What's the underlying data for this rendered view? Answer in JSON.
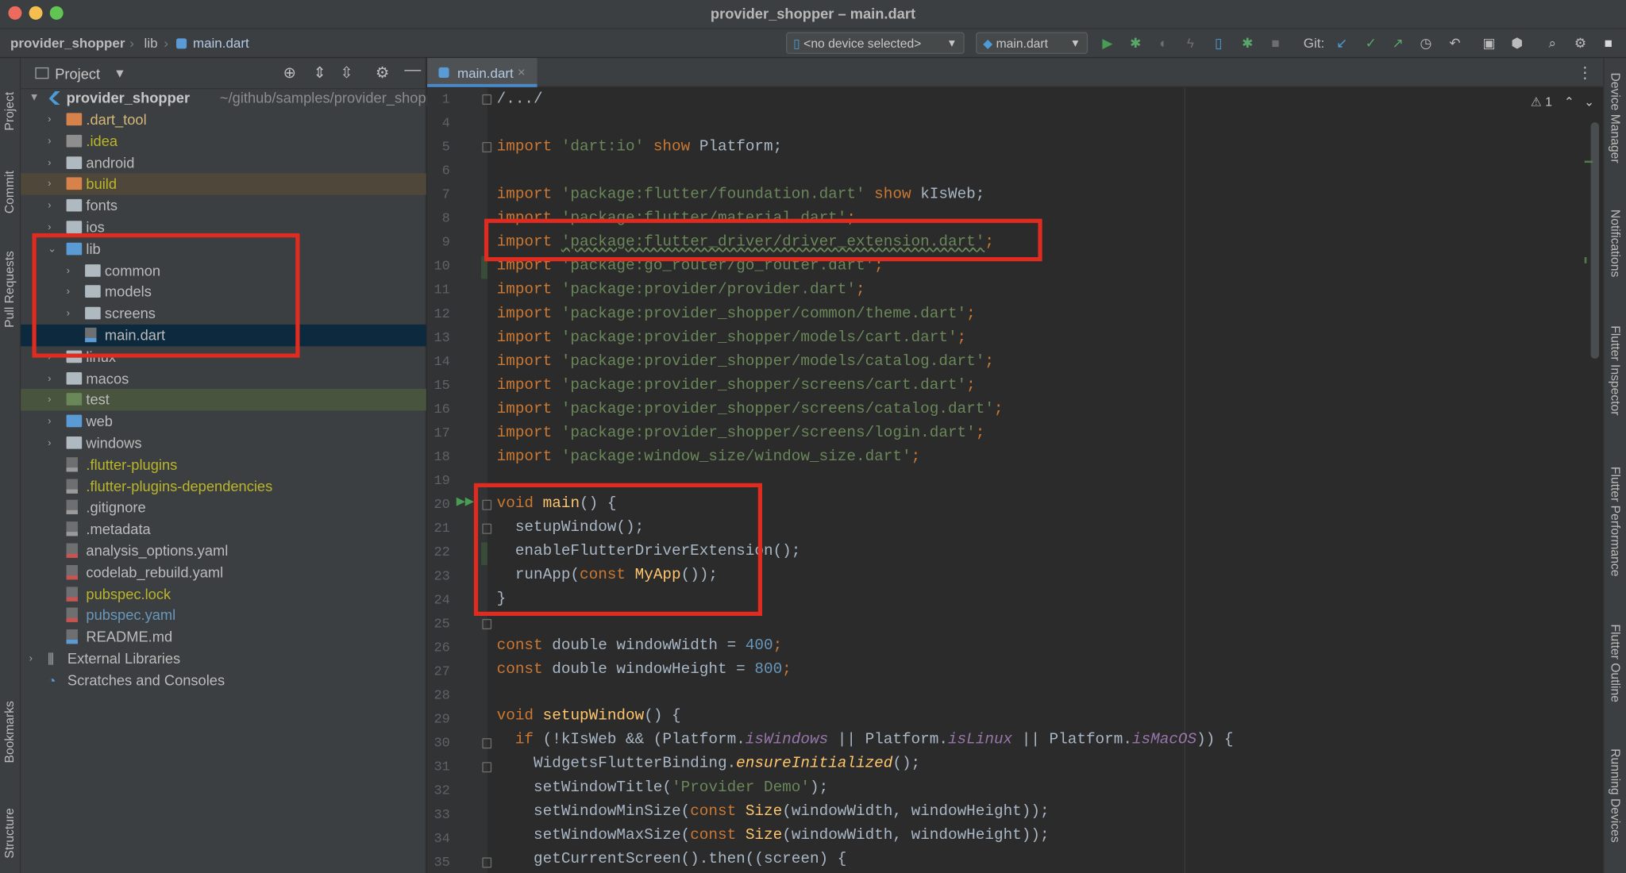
{
  "window": {
    "title": "provider_shopper – main.dart"
  },
  "breadcrumb": [
    "provider_shopper",
    "lib",
    "main.dart"
  ],
  "toolbar": {
    "device_selector": "<no device selected>",
    "run_config": "main.dart",
    "git_label": "Git:"
  },
  "left_stripe": [
    "Project",
    "Commit",
    "Pull Requests",
    "Bookmarks",
    "Structure"
  ],
  "right_stripe": [
    "Device Manager",
    "Notifications",
    "Flutter Inspector",
    "Flutter Performance",
    "Flutter Outline",
    "Running Devices"
  ],
  "project_panel": {
    "title": "Project",
    "root_name": "provider_shopper",
    "root_path": "~/github/samples/provider_shopper",
    "items": [
      {
        "label": ".dart_tool",
        "color": "#d5b778"
      },
      {
        "label": ".idea",
        "color": "#bbb529"
      },
      {
        "label": "android",
        "color": "#bbbbbb"
      },
      {
        "label": "build",
        "color": "#bbb529"
      },
      {
        "label": "fonts",
        "color": "#bbbbbb"
      },
      {
        "label": "ios",
        "color": "#bbbbbb"
      },
      {
        "label": "lib",
        "color": "#bbbbbb"
      },
      {
        "label": "common",
        "color": "#bbbbbb"
      },
      {
        "label": "models",
        "color": "#bbbbbb"
      },
      {
        "label": "screens",
        "color": "#bbbbbb"
      },
      {
        "label": "main.dart",
        "color": "#bbbbbb"
      },
      {
        "label": "linux",
        "color": "#bbbbbb"
      },
      {
        "label": "macos",
        "color": "#bbbbbb"
      },
      {
        "label": "test",
        "color": "#bbbbbb"
      },
      {
        "label": "web",
        "color": "#bbbbbb"
      },
      {
        "label": "windows",
        "color": "#bbbbbb"
      },
      {
        "label": ".flutter-plugins",
        "color": "#bbb529"
      },
      {
        "label": ".flutter-plugins-dependencies",
        "color": "#bbb529"
      },
      {
        "label": ".gitignore",
        "color": "#bbbbbb"
      },
      {
        "label": ".metadata",
        "color": "#bbbbbb"
      },
      {
        "label": "analysis_options.yaml",
        "color": "#bbbbbb"
      },
      {
        "label": "codelab_rebuild.yaml",
        "color": "#bbbbbb"
      },
      {
        "label": "pubspec.lock",
        "color": "#bbb529"
      },
      {
        "label": "pubspec.yaml",
        "color": "#6897bb"
      },
      {
        "label": "README.md",
        "color": "#bbbbbb"
      },
      {
        "label": "External Libraries",
        "color": "#bbbbbb"
      },
      {
        "label": "Scratches and Consoles",
        "color": "#bbbbbb"
      }
    ]
  },
  "editor": {
    "tab_label": "main.dart",
    "inspection": "1",
    "line_numbers": [
      "1",
      "4",
      "5",
      "6",
      "7",
      "8",
      "9",
      "10",
      "11",
      "12",
      "13",
      "14",
      "15",
      "16",
      "17",
      "18",
      "19",
      "20",
      "21",
      "22",
      "23",
      "24",
      "25",
      "26",
      "27",
      "28",
      "29",
      "30",
      "31",
      "32",
      "33",
      "34",
      "35"
    ],
    "code": {
      "l1": "/.../",
      "l5a": "import",
      "l5b": "'dart:io'",
      "l5c": "show",
      "l5d": " Platform;",
      "l7a": "import",
      "l7b": "'package:flutter/foundation.dart'",
      "l7c": "show",
      "l7d": " kIsWeb;",
      "l8a": "import",
      "l8b": "'package:flutter/material.dart'",
      "l8c": ";",
      "l9a": "import",
      "l9b": "'package:flutter_driver/driver_extension.dart'",
      "l9c": ";",
      "l10a": "import",
      "l10b": "'package:go_router/go_router.dart'",
      "l10c": ";",
      "l11a": "import",
      "l11b": "'package:provider/provider.dart'",
      "l11c": ";",
      "l12a": "import",
      "l12b": "'package:provider_shopper/common/theme.dart'",
      "l12c": ";",
      "l13a": "import",
      "l13b": "'package:provider_shopper/models/cart.dart'",
      "l13c": ";",
      "l14a": "import",
      "l14b": "'package:provider_shopper/models/catalog.dart'",
      "l14c": ";",
      "l15a": "import",
      "l15b": "'package:provider_shopper/screens/cart.dart'",
      "l15c": ";",
      "l16a": "import",
      "l16b": "'package:provider_shopper/screens/catalog.dart'",
      "l16c": ";",
      "l17a": "import",
      "l17b": "'package:provider_shopper/screens/login.dart'",
      "l17c": ";",
      "l18a": "import",
      "l18b": "'package:window_size/window_size.dart'",
      "l18c": ";",
      "l20a": "void",
      "l20b": "main",
      "l20c": "() {",
      "l21": "  setupWindow();",
      "l22": "  enableFlutterDriverExtension();",
      "l23a": "  runApp(",
      "l23b": "const",
      "l23c": "MyApp",
      "l23d": "());",
      "l24": "}",
      "l26a": "const",
      "l26b": " double windowWidth = ",
      "l26c": "400",
      "l26d": ";",
      "l27a": "const",
      "l27b": " double windowHeight = ",
      "l27c": "800",
      "l27d": ";",
      "l29a": "void",
      "l29b": "setupWindow",
      "l29c": "() {",
      "l30a": "  ",
      "l30b": "if",
      "l30c": " (!kIsWeb && (Platform.",
      "l30d": "isWindows",
      "l30e": " || Platform.",
      "l30f": "isLinux",
      "l30g": " || Platform.",
      "l30h": "isMacOS",
      "l30i": ")) {",
      "l31a": "    WidgetsFlutterBinding.",
      "l31b": "ensureInitialized",
      "l31c": "();",
      "l32a": "    setWindowTitle(",
      "l32b": "'Provider Demo'",
      "l32c": ");",
      "l33a": "    setWindowMinSize(",
      "l33b": "const",
      "l33c": "Size",
      "l33d": "(windowWidth, windowHeight));",
      "l34a": "    setWindowMaxSize(",
      "l34b": "const",
      "l34c": "Size",
      "l34d": "(windowWidth, windowHeight));",
      "l35": "    getCurrentScreen().then((screen) {"
    }
  }
}
